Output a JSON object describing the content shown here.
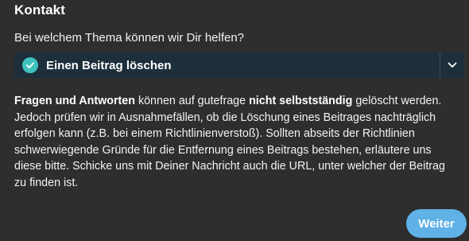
{
  "dialog": {
    "title": "Kontakt",
    "question": "Bei welchem Thema können wir Dir helfen?"
  },
  "topic_select": {
    "selected_label": "Einen Beitrag löschen",
    "selected_icon": "check-circle-icon",
    "dropdown_icon": "chevron-down-icon",
    "background_color": "#1d2f3b",
    "check_color": "#40c2bf"
  },
  "info": {
    "seg1_bold": "Fragen und Antworten",
    "seg2": " können auf gutefrage ",
    "seg3_bold": "nicht selbstständig",
    "seg4": " gelöscht werden. Jedoch prüfen wir in Ausnahmefällen, ob die Löschung eines Beitrages nachträglich erfolgen kann (z.B. bei einem Richtlinienverstoß). Sollten abseits der Richtlinien schwerwiegende Gründe für die Entfernung eines Beitrags bestehen, erläutere uns diese bitte. Schicke uns mit Deiner Nachricht auch die URL, unter welcher der Beitrag zu finden ist."
  },
  "actions": {
    "next_label": "Weiter",
    "next_color": "#5fb1e6"
  }
}
